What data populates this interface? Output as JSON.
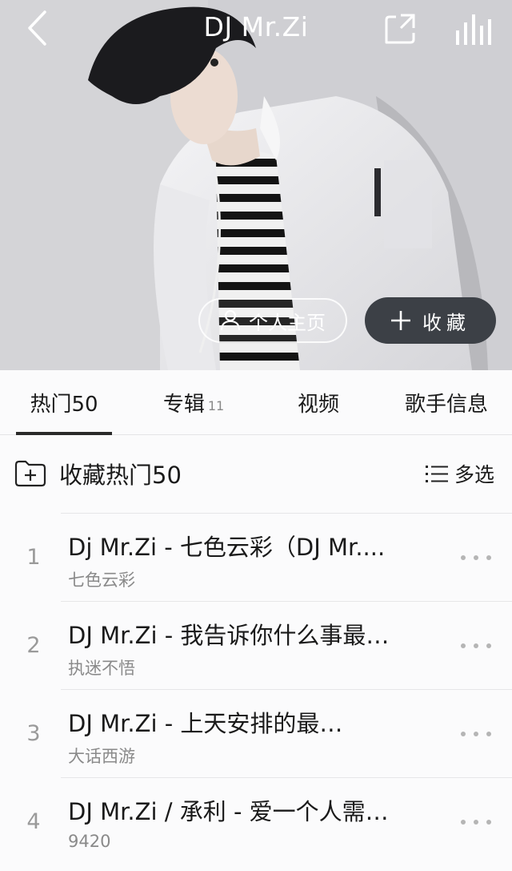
{
  "header": {
    "title": "DJ Mr.Zi",
    "back_icon": "chevron-left-icon",
    "share_icon": "share-icon",
    "equalizer_icon": "equalizer-icon"
  },
  "hero": {
    "profile_label": "个人主页",
    "profile_icon": "person-icon",
    "favorite_label": "收藏",
    "favorite_icon": "plus-icon"
  },
  "tabs": [
    {
      "label": "热门50",
      "active": true
    },
    {
      "label": "专辑",
      "count": "11"
    },
    {
      "label": "视频"
    },
    {
      "label": "歌手信息"
    }
  ],
  "toolbar": {
    "collect_label": "收藏热门50",
    "collect_icon": "folder-plus-icon",
    "multi_select_label": "多选",
    "multi_select_icon": "list-icon"
  },
  "songs": [
    {
      "index": "1",
      "title": "Dj Mr.Zi - 七色云彩（DJ Mr....",
      "album": "七色云彩"
    },
    {
      "index": "2",
      "title": "DJ Mr.Zi - 我告诉你什么事最…",
      "album": "执迷不悟"
    },
    {
      "index": "3",
      "title": "DJ Mr.Zi - 上天安排的最…",
      "album": "大话西游"
    },
    {
      "index": "4",
      "title": "DJ Mr.Zi / 承利 - 爱一个人需…",
      "album": "9420"
    }
  ],
  "colors": {
    "accent_dark": "#3c4046",
    "text_primary": "#1a1a1a",
    "text_secondary": "#8a8a8a"
  }
}
